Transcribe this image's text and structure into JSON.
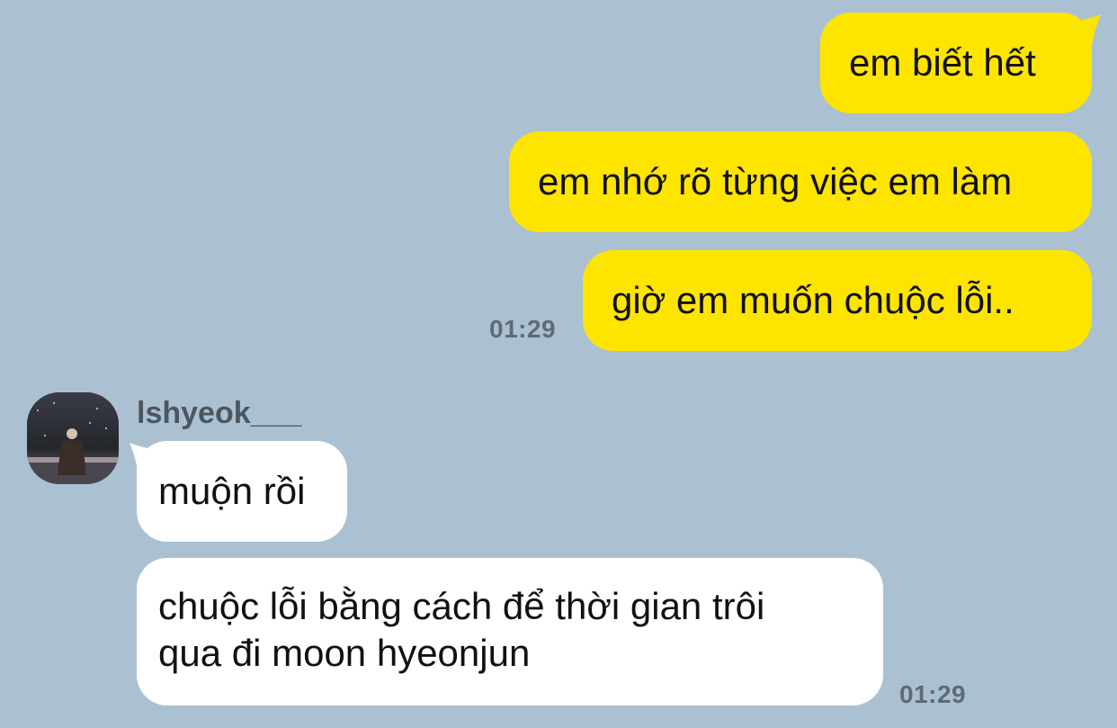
{
  "chat": {
    "sent_messages": [
      {
        "text": "em biết hết"
      },
      {
        "text": "em nhớ rõ từng việc em làm"
      },
      {
        "text": "giờ em muốn chuộc lỗi.."
      }
    ],
    "sent_time": "01:29",
    "sender": {
      "name": "lshyeok___",
      "avatar": "profile-photo"
    },
    "received_messages": [
      {
        "text": "muộn rồi"
      },
      {
        "lines": [
          "chuộc lỗi bằng cách để thời gian trôi",
          "qua đi moon hyeonjun"
        ]
      }
    ],
    "received_time": "01:29"
  },
  "colors": {
    "background": "#abc1d1",
    "sent_bubble": "#fee500",
    "received_bubble": "#ffffff",
    "timestamp": "#5e6b76"
  }
}
